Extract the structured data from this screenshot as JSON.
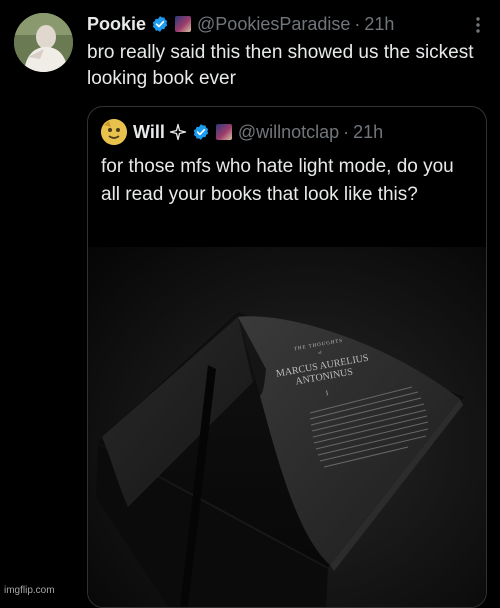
{
  "post": {
    "author_name": "Pookie",
    "handle": "@PookiesParadise",
    "separator": "·",
    "time": "21h",
    "text": "bro really said this then showed us the sickest looking book ever"
  },
  "quote": {
    "author_name": "Will",
    "handle": "@willnotclap",
    "separator": "·",
    "time": "21h",
    "text": "for those mfs who hate light mode, do you all read your books that look like this?",
    "media": {
      "book_small_heading": "THE THOUGHTS",
      "book_small_heading_2": "of",
      "book_title_line1": "MARCUS AURELIUS",
      "book_title_line2": "ANTONINUS",
      "book_chapter": "I"
    }
  },
  "watermark": "imgflip.com",
  "colors": {
    "background": "#000000",
    "text_primary": "#e7e9ea",
    "text_secondary": "#71767b",
    "verified_blue": "#1d9bf0",
    "border": "#2f3336"
  },
  "icons": [
    "verified-badge-icon",
    "more-options-icon",
    "sparkle-icon"
  ]
}
